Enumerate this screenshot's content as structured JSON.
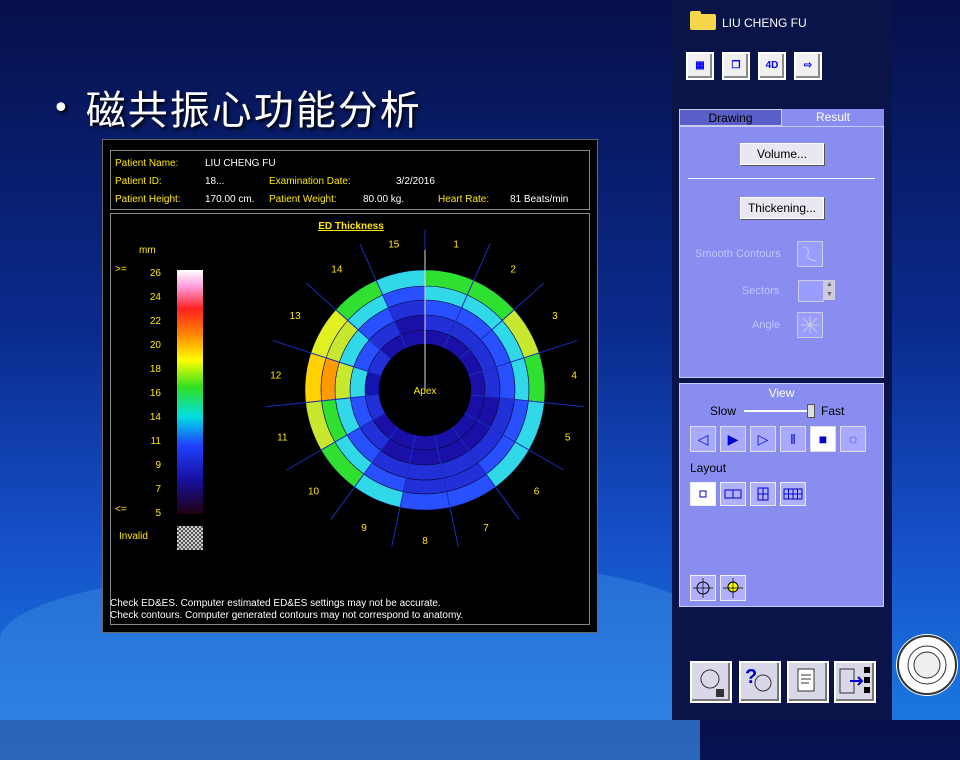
{
  "slide": {
    "title": "磁共振心功能分析"
  },
  "patient_info": {
    "name_label": "Patient Name:",
    "name": "LIU CHENG FU",
    "id_label": "Patient ID:",
    "id": "18...",
    "exam_label": "Examination Date:",
    "exam_date": "3/2/2016",
    "height_label": "Patient Height:",
    "height": "170.00 cm.",
    "weight_label": "Patient Weight:",
    "weight": "80.00 kg.",
    "hr_label": "Heart Rate:",
    "heart_rate": "81 Beats/min"
  },
  "plot": {
    "title": "ED Thickness",
    "scale_unit": "mm",
    "scale_ge": ">=",
    "scale_le": "<=",
    "scale_ticks": [
      "26",
      "24",
      "22",
      "20",
      "18",
      "16",
      "14",
      "11",
      "9",
      "7",
      "5"
    ],
    "invalid_label": "Invalid",
    "apex_label": "Apex",
    "sectors": [
      "1",
      "2",
      "3",
      "4",
      "5",
      "6",
      "7",
      "8",
      "9",
      "10",
      "11",
      "12",
      "13",
      "14",
      "15"
    ]
  },
  "messages": [
    "Check ED&ES. Computer estimated ED&ES settings may not be accurate.",
    "Check contours. Computer generated contours may not correspond to anatomy."
  ],
  "panel": {
    "patient_name": "LIU CHENG FU",
    "tab_drawing": "Drawing",
    "tab_result": "Result",
    "volume_button": "Volume...",
    "thickening_button": "Thickening...",
    "smooth_label": "Smooth Contours",
    "sectors_label": "Sectors",
    "angle_label": "Angle",
    "view_title": "View",
    "slow_label": "Slow",
    "fast_label": "Fast",
    "layout_label": "Layout",
    "toolbar_4d": "4D"
  },
  "colors": {
    "panel_bg": "#8a8df0",
    "label": "#ffe800"
  }
}
